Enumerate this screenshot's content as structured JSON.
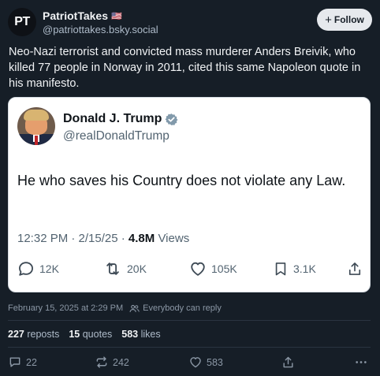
{
  "post": {
    "avatar_text": "PT",
    "author_name": "PatriotTakes",
    "author_flag": "🇺🇸",
    "author_handle": "@patriottakes.bsky.social",
    "follow_label": "Follow",
    "text": "Neo-Nazi terrorist and convicted mass murderer Anders Breivik, who killed 77 people in Norway in 2011, cited this same Napoleon quote in his manifesto.",
    "timestamp": "February 15, 2025 at 2:29 PM",
    "reply_permission": "Everybody can reply",
    "stats": {
      "reposts_count": "227",
      "reposts_label": "reposts",
      "quotes_count": "15",
      "quotes_label": "quotes",
      "likes_count": "583",
      "likes_label": "likes"
    },
    "actions": {
      "reply_count": "22",
      "repost_count": "242",
      "like_count": "583"
    }
  },
  "quoted": {
    "author_name": "Donald J. Trump",
    "author_handle": "@realDonaldTrump",
    "text": "He who saves his Country does not violate any Law.",
    "time": "12:32 PM · 2/15/25 · ",
    "views_count": "4.8M",
    "views_label": " Views",
    "actions": {
      "reply_count": "12K",
      "repost_count": "20K",
      "like_count": "105K",
      "bookmark_count": "3.1K"
    }
  },
  "colors": {
    "background": "#161e27",
    "card": "#ffffff",
    "verified": "#829aab",
    "muted": "#8b97a5"
  }
}
